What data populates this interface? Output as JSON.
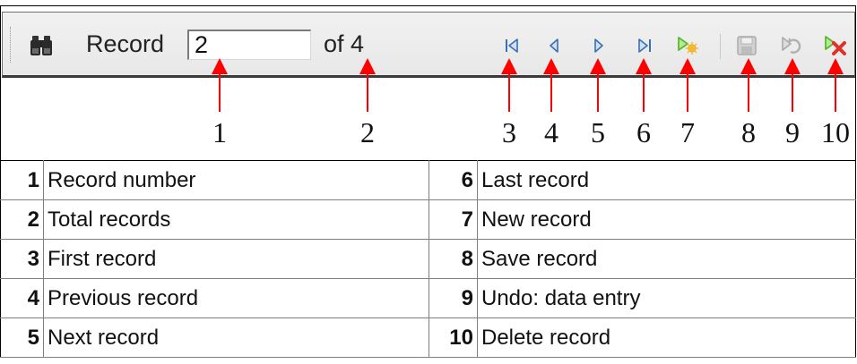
{
  "toolbar": {
    "record_label": "Record",
    "record_value": "2",
    "of_label": "of 4",
    "buttons": [
      {
        "id": "first",
        "icon": "first-record-icon"
      },
      {
        "id": "previous",
        "icon": "previous-record-icon"
      },
      {
        "id": "next",
        "icon": "next-record-icon"
      },
      {
        "id": "last",
        "icon": "last-record-icon"
      },
      {
        "id": "new",
        "icon": "new-record-icon"
      },
      {
        "id": "save",
        "icon": "save-record-icon",
        "disabled": true
      },
      {
        "id": "undo",
        "icon": "undo-icon",
        "disabled": true
      },
      {
        "id": "delete",
        "icon": "delete-record-icon"
      }
    ]
  },
  "callouts": [
    "1",
    "2",
    "3",
    "4",
    "5",
    "6",
    "7",
    "8",
    "9",
    "10"
  ],
  "legend": {
    "rows": [
      {
        "left_num": "1",
        "left_label": "Record number",
        "right_num": "6",
        "right_label": "Last record"
      },
      {
        "left_num": "2",
        "left_label": "Total records",
        "right_num": "7",
        "right_label": "New record"
      },
      {
        "left_num": "3",
        "left_label": "First record",
        "right_num": "8",
        "right_label": "Save record"
      },
      {
        "left_num": "4",
        "left_label": "Previous record",
        "right_num": "9",
        "right_label": "Undo: data entry"
      },
      {
        "left_num": "5",
        "left_label": "Next record",
        "right_num": "10",
        "right_label": "Delete record"
      }
    ]
  },
  "colors": {
    "callout": "#ff0000",
    "nav_arrow": "#3a6fb0",
    "new_arrow": "#5cb82e",
    "delete_x": "#e0302a",
    "disabled": "#a9a9a9"
  }
}
